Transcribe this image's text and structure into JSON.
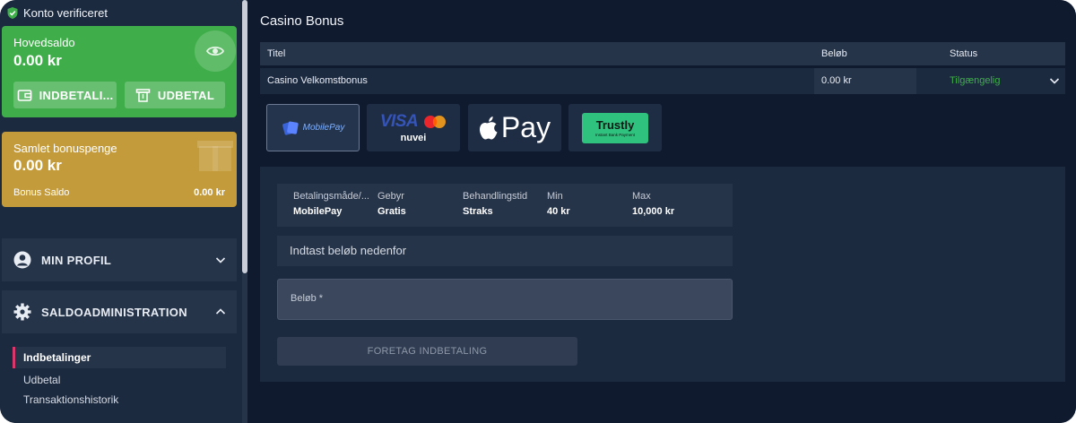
{
  "sidebar": {
    "verified_label": "Konto verificeret",
    "main_balance": {
      "label": "Hovedsaldo",
      "amount": "0.00 kr",
      "deposit_label": "INDBETALI...",
      "withdraw_label": "UDBETAL"
    },
    "bonus_balance": {
      "label": "Samlet bonuspenge",
      "amount": "0.00 kr",
      "sub_label": "Bonus Saldo",
      "sub_value": "0.00 kr"
    },
    "menu": {
      "profile_label": "MIN PROFIL",
      "saldo_label": "SALDOADMINISTRATION"
    },
    "submenu": [
      {
        "label": "Indbetalinger",
        "active": true
      },
      {
        "label": "Udbetal",
        "active": false
      },
      {
        "label": "Transaktionshistorik",
        "active": false
      }
    ]
  },
  "main": {
    "title": "Casino Bonus",
    "table": {
      "headers": [
        "Titel",
        "Beløb",
        "Status"
      ],
      "rows": [
        {
          "title": "Casino Velkomstbonus",
          "amount": "0.00 kr",
          "status": "Tilgængelig"
        }
      ]
    },
    "payment_methods": {
      "mobilepay": "MobilePay",
      "visa": "VISA",
      "nuvei": "nuvei",
      "applepay": "Pay",
      "trustly": "Trustly",
      "trustly_sub": "Instant Bank Payment"
    },
    "deposit": {
      "info": [
        {
          "header": "Betalingsmåde/...",
          "value": "MobilePay"
        },
        {
          "header": "Gebyr",
          "value": "Gratis"
        },
        {
          "header": "Behandlingstid",
          "value": "Straks"
        },
        {
          "header": "Min",
          "value": "40 kr"
        },
        {
          "header": "Max",
          "value": "10,000 kr"
        }
      ],
      "instruction": "Indtast beløb nedenfor",
      "amount_placeholder": "Beløb *",
      "submit_label": "FORETAG INDBETALING"
    }
  },
  "colors": {
    "green": "#3fae4a",
    "gold": "#c49b3a",
    "accent_pink": "#d8386b",
    "status_available": "#3fae4a"
  }
}
